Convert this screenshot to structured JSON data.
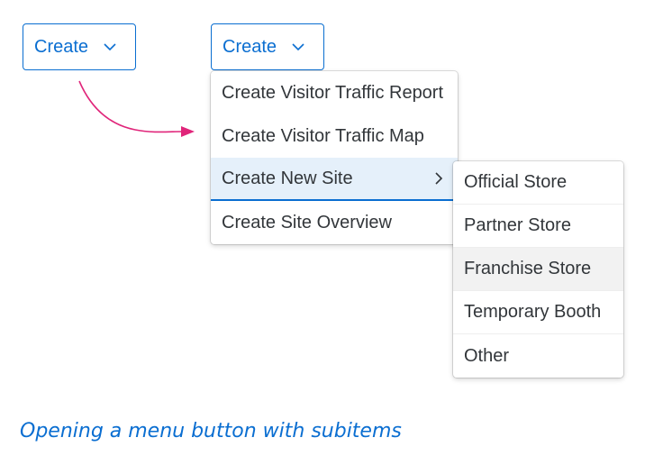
{
  "colors": {
    "accent": "#0a6ed1",
    "arrow": "#e0257a",
    "text": "#32363a",
    "selected_bg": "#e5f0fa",
    "hover_bg": "#f2f2f2"
  },
  "buttons": {
    "left": {
      "label": "Create",
      "icon": "chevron-down-icon"
    },
    "right": {
      "label": "Create",
      "icon": "chevron-down-icon"
    }
  },
  "menu": {
    "items": [
      {
        "label": "Create Visitor Traffic Report"
      },
      {
        "label": "Create Visitor Traffic Map"
      },
      {
        "label": "Create New Site",
        "has_submenu": true,
        "icon": "chevron-right-icon"
      },
      {
        "label": "Create Site Overview"
      }
    ]
  },
  "submenu": {
    "items": [
      {
        "label": "Official Store"
      },
      {
        "label": "Partner Store"
      },
      {
        "label": "Franchise Store"
      },
      {
        "label": "Temporary Booth"
      },
      {
        "label": "Other"
      }
    ]
  },
  "caption": "Opening a menu button with subitems"
}
